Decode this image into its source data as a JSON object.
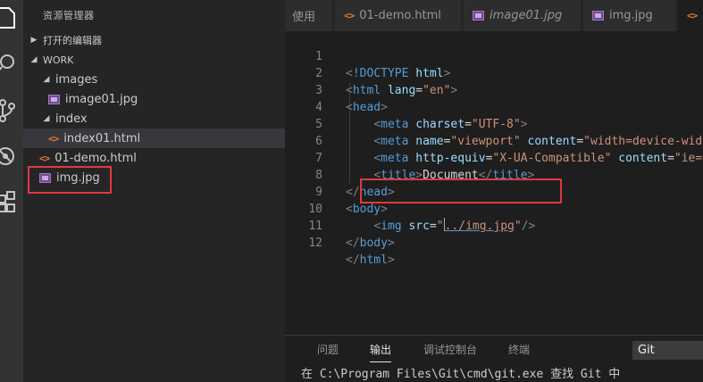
{
  "activity_bar": {
    "icons": [
      "files-icon",
      "search-icon",
      "source-control-icon",
      "debug-icon",
      "extensions-icon"
    ]
  },
  "sidebar": {
    "title": "资源管理器",
    "open_editors_label": "打开的编辑器",
    "workspace_label": "WORK",
    "tree": [
      {
        "label": "images",
        "type": "folder"
      },
      {
        "label": "image01.jpg",
        "type": "image"
      },
      {
        "label": "index",
        "type": "folder"
      },
      {
        "label": "index01.html",
        "type": "html",
        "selected": true
      },
      {
        "label": "01-demo.html",
        "type": "html"
      },
      {
        "label": "img.jpg",
        "type": "image"
      }
    ]
  },
  "tabs": [
    {
      "label": "使用",
      "type": "truncated"
    },
    {
      "label": "01-demo.html",
      "type": "html"
    },
    {
      "label": "image01.jpg",
      "type": "image",
      "italic": true
    },
    {
      "label": "img.jpg",
      "type": "image"
    },
    {
      "label": "i",
      "type": "html"
    }
  ],
  "editor": {
    "line_numbers": [
      "1",
      "2",
      "3",
      "4",
      "5",
      "6",
      "7",
      "8",
      "9",
      "10",
      "11",
      "12"
    ]
  },
  "panel": {
    "tabs": [
      "问题",
      "输出",
      "调试控制台",
      "终端"
    ],
    "active_tab": "输出",
    "channel_select": "Git",
    "output_line": "在 C:\\Program Files\\Git\\cmd\\git.exe 查找 Git 中"
  },
  "colors": {
    "highlight_box": "#e0393e",
    "tag": "#569cd6",
    "attribute": "#9cdcfe",
    "string": "#ce9178"
  }
}
